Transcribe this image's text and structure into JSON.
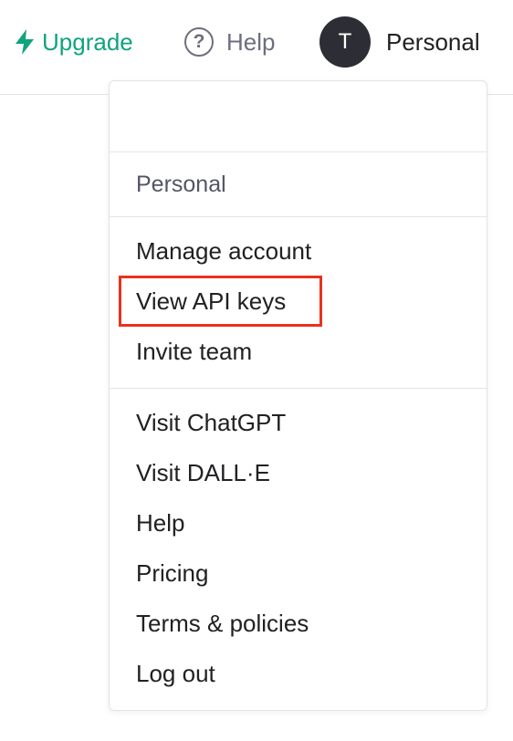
{
  "topbar": {
    "upgrade_label": "Upgrade",
    "help_label": "Help",
    "help_icon_glyph": "?",
    "avatar_initial": "T",
    "account_name": "Personal"
  },
  "dropdown": {
    "section_title": "Personal",
    "account_items": [
      {
        "label": "Manage account"
      },
      {
        "label": "View API keys",
        "highlighted": true
      },
      {
        "label": "Invite team"
      }
    ],
    "link_items": [
      {
        "label": "Visit ChatGPT"
      },
      {
        "label": "Visit DALL·E"
      },
      {
        "label": "Help"
      },
      {
        "label": "Pricing"
      },
      {
        "label": "Terms & policies"
      },
      {
        "label": "Log out"
      }
    ]
  },
  "colors": {
    "accent": "#10a37f",
    "avatar_bg": "#2d2e35",
    "highlight_box": "#e8321f",
    "muted_text": "#6e6e80"
  },
  "icons": {
    "upgrade": "lightning-bolt-icon",
    "help": "question-circle-icon"
  }
}
